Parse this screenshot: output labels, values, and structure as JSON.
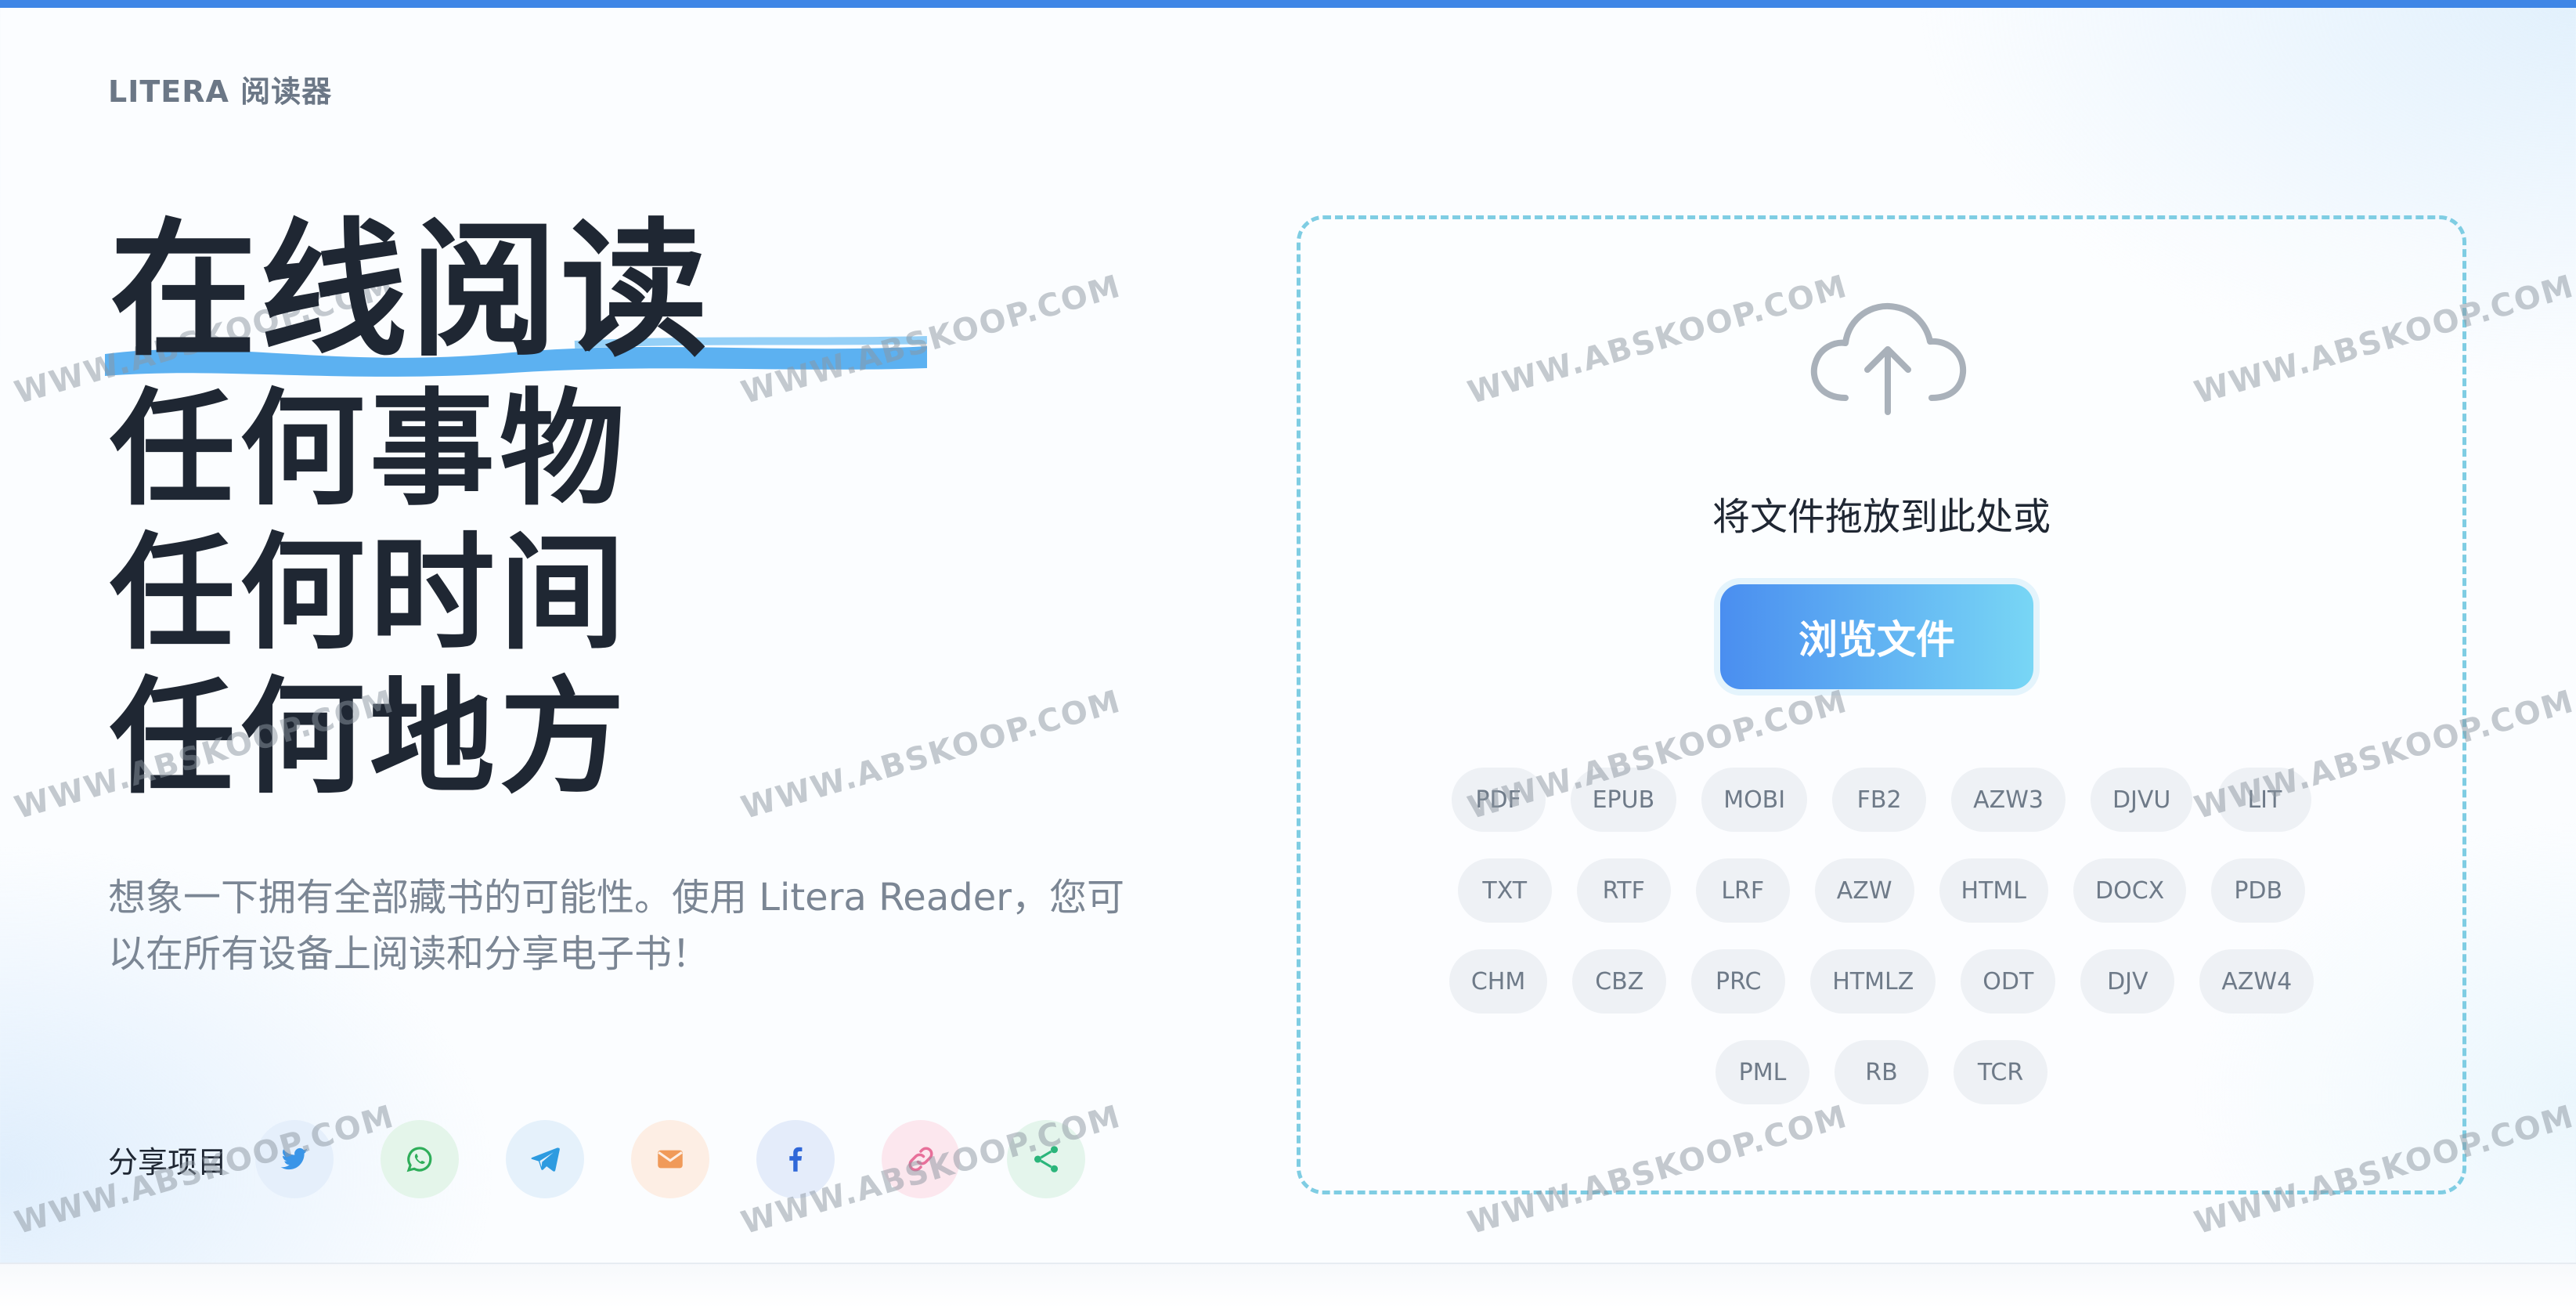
{
  "brand": "LITERA 阅读器",
  "hero": {
    "line1": "在线阅读",
    "line2": "任何事物",
    "line3": "任何时间",
    "line4": "任何地方"
  },
  "description": "想象一下拥有全部藏书的可能性。使用 Litera Reader，您可以在所有设备上阅读和分享电子书！",
  "share": {
    "label": "分享项目",
    "buttons": [
      {
        "name": "twitter-icon",
        "bg": "#e5effb",
        "color": "#3a95e8"
      },
      {
        "name": "whatsapp-icon",
        "bg": "#e4f5ea",
        "color": "#2fae5a"
      },
      {
        "name": "telegram-icon",
        "bg": "#e5f1fb",
        "color": "#2d9be0"
      },
      {
        "name": "email-icon",
        "bg": "#fdeee4",
        "color": "#f09a59"
      },
      {
        "name": "facebook-icon",
        "bg": "#e4ecfa",
        "color": "#2f67d8"
      },
      {
        "name": "link-icon",
        "bg": "#fce7ee",
        "color": "#e8709a"
      },
      {
        "name": "share-icon",
        "bg": "#e4f5ec",
        "color": "#2bb57b"
      }
    ]
  },
  "dropzone": {
    "text": "将文件拖放到此处或",
    "button": "浏览文件"
  },
  "formats": [
    [
      "PDF",
      "EPUB",
      "MOBI",
      "FB2",
      "AZW3",
      "DJVU",
      "LIT"
    ],
    [
      "TXT",
      "RTF",
      "LRF",
      "AZW",
      "HTML",
      "DOCX",
      "PDB"
    ],
    [
      "CHM",
      "CBZ",
      "PRC",
      "HTMLZ",
      "ODT",
      "DJV",
      "AZW4"
    ],
    [
      "PML",
      "RB",
      "TCR"
    ]
  ],
  "watermark": "WWW.ABSKOOP.COM",
  "colors": {
    "accent": "#3f86e6",
    "brush": "#4aa8f0",
    "dash": "#7fcde3"
  }
}
